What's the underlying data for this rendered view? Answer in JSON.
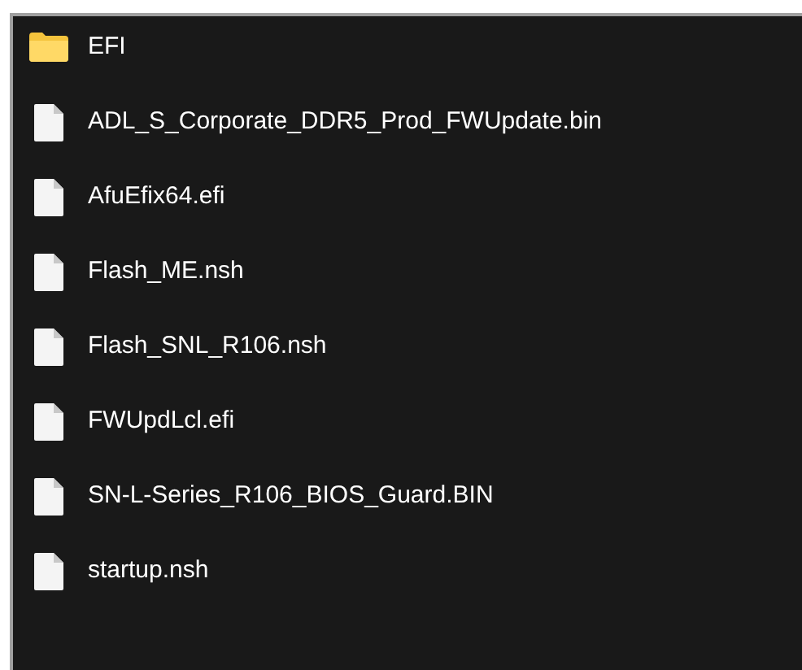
{
  "files": [
    {
      "name": "EFI",
      "kind": "folder"
    },
    {
      "name": "ADL_S_Corporate_DDR5_Prod_FWUpdate.bin",
      "kind": "file"
    },
    {
      "name": "AfuEfix64.efi",
      "kind": "file"
    },
    {
      "name": "Flash_ME.nsh",
      "kind": "file"
    },
    {
      "name": "Flash_SNL_R106.nsh",
      "kind": "file"
    },
    {
      "name": "FWUpdLcl.efi",
      "kind": "file"
    },
    {
      "name": "SN-L-Series_R106_BIOS_Guard.BIN",
      "kind": "file"
    },
    {
      "name": "startup.nsh",
      "kind": "file"
    }
  ]
}
